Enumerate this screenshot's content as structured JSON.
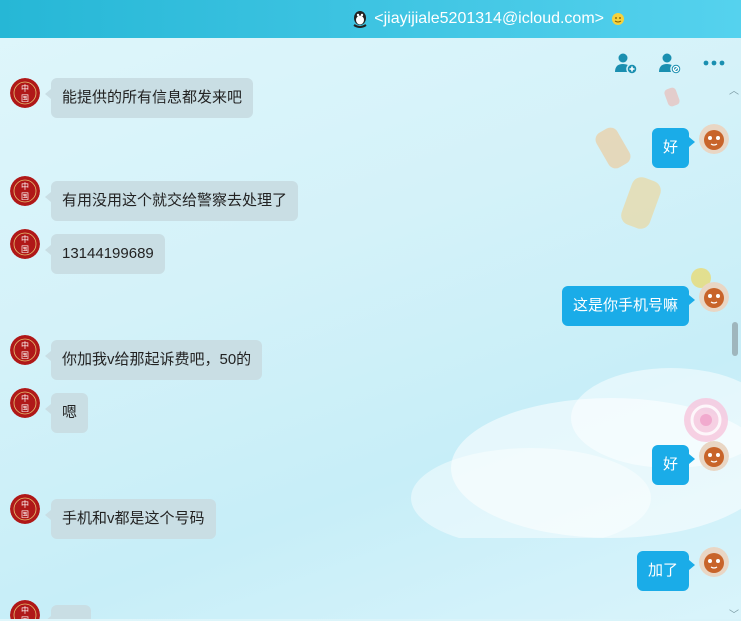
{
  "window": {
    "title": "<jiayijiale5201314@icloud.com>",
    "title_icon": "qq-penguin-icon",
    "status_icon": "sun-icon"
  },
  "toolbar": {
    "add_friend_icon": "add-user-icon",
    "block_icon": "block-user-icon",
    "more_icon": "more-icon"
  },
  "colors": {
    "titlebar": "#26b7d6",
    "outgoing_bubble": "#1aace8",
    "incoming_bubble": "#c9dee4"
  },
  "messages": [
    {
      "side": "left",
      "text": "能提供的所有信息都发来吧"
    },
    {
      "side": "right",
      "text": "好"
    },
    {
      "side": "left",
      "text": "有用没用这个就交给警察去处理了"
    },
    {
      "side": "left",
      "text": "13144199689"
    },
    {
      "side": "right",
      "text": "这是你手机号嘛"
    },
    {
      "side": "left",
      "text": "你加我v给那起诉费吧，50的"
    },
    {
      "side": "left",
      "text": "嗯"
    },
    {
      "side": "right",
      "text": "好"
    },
    {
      "side": "left",
      "text": "手机和v都是这个号码"
    },
    {
      "side": "right",
      "text": "加了"
    },
    {
      "side": "left",
      "text": ""
    }
  ]
}
